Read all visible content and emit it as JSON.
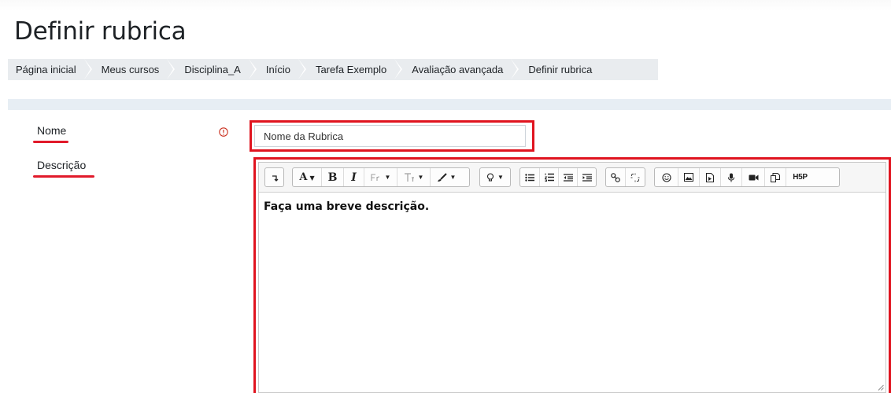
{
  "page": {
    "title": "Definir rubrica"
  },
  "breadcrumb": {
    "items": [
      {
        "label": "Página inicial"
      },
      {
        "label": "Meus cursos"
      },
      {
        "label": "Disciplina_A"
      },
      {
        "label": "Início"
      },
      {
        "label": "Tarefa Exemplo"
      },
      {
        "label": "Avaliação avançada"
      },
      {
        "label": "Definir rubrica"
      }
    ]
  },
  "form": {
    "name_label": "Nome",
    "name_value": "Nome da Rubrica",
    "required_icon": "exclamation-circle-icon",
    "description_label": "Descrição",
    "description_content": "Faça uma breve descrição."
  },
  "toolbar": {
    "groups": [
      [
        "collapse"
      ],
      [
        "font-color",
        "bold",
        "italic",
        "font-family",
        "font-size",
        "brush"
      ],
      [
        "lightbulb"
      ],
      [
        "unordered-list",
        "ordered-list",
        "outdent",
        "indent"
      ],
      [
        "link",
        "unlink"
      ],
      [
        "emoji",
        "image",
        "media",
        "record-audio",
        "record-video",
        "manage-files",
        "h5p"
      ]
    ],
    "labels": {
      "bold": "B",
      "italic": "I",
      "h5p": "H5P"
    }
  },
  "colors": {
    "highlight": "#e0141f",
    "breadcrumb_bg": "#e9ecef",
    "required": "#ca3120"
  }
}
